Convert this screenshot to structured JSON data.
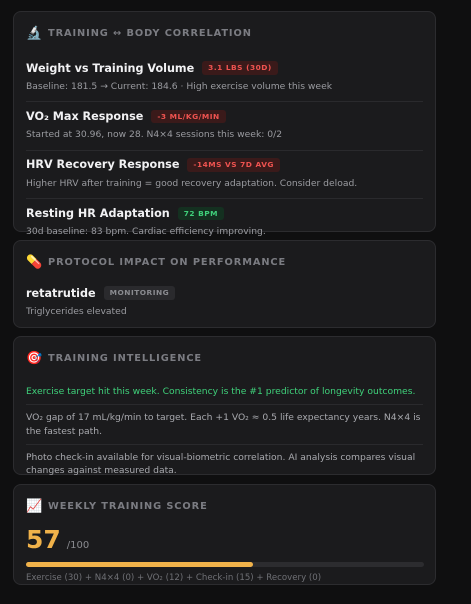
{
  "correlation": {
    "icon": "microscope-icon",
    "title": "TRAINING ↔ BODY CORRELATION",
    "rows": [
      {
        "title": "Weight vs Training Volume",
        "badge": "3.1 LBS (30D)",
        "badge_type": "red",
        "subtitle": "Baseline: 181.5 → Current: 184.6 · High exercise volume this week"
      },
      {
        "title": "VO₂ Max Response",
        "badge": "-3 ML/KG/MIN",
        "badge_type": "red",
        "subtitle": "Started at 30.96, now 28. N4×4 sessions this week: 0/2"
      },
      {
        "title": "HRV Recovery Response",
        "badge": "-14MS VS 7D AVG",
        "badge_type": "red",
        "subtitle": "Higher HRV after training = good recovery adaptation. Consider deload."
      },
      {
        "title": "Resting HR Adaptation",
        "badge": "72 BPM",
        "badge_type": "green",
        "subtitle": "30d baseline: 83 bpm. Cardiac efficiency improving."
      }
    ]
  },
  "protocol": {
    "icon": "pill-icon",
    "title": "PROTOCOL IMPACT ON PERFORMANCE",
    "item": {
      "title": "retatrutide",
      "badge": "MONITORING",
      "subtitle": "Triglycerides elevated"
    }
  },
  "intelligence": {
    "icon": "target-icon",
    "title": "TRAINING INTELLIGENCE",
    "lines": [
      "Exercise target hit this week. Consistency is the #1 predictor of longevity outcomes.",
      "VO₂ gap of 17 mL/kg/min to target. Each +1 VO₂ ≈ 0.5 life expectancy years. N4×4 is the fastest path.",
      "Photo check-in available for visual-biometric correlation. AI analysis compares visual changes against measured data."
    ]
  },
  "score": {
    "icon": "chart-icon",
    "title": "WEEKLY TRAINING SCORE",
    "value": "57",
    "max": "/100",
    "progress_fraction": 0.57,
    "breakdown": "Exercise (30) + N4×4 (0) + VO₂ (12) + Check-in (15) + Recovery (0)"
  },
  "colors": {
    "red": "#ef5350",
    "green": "#3fd07a",
    "amber": "#f0b24a"
  }
}
